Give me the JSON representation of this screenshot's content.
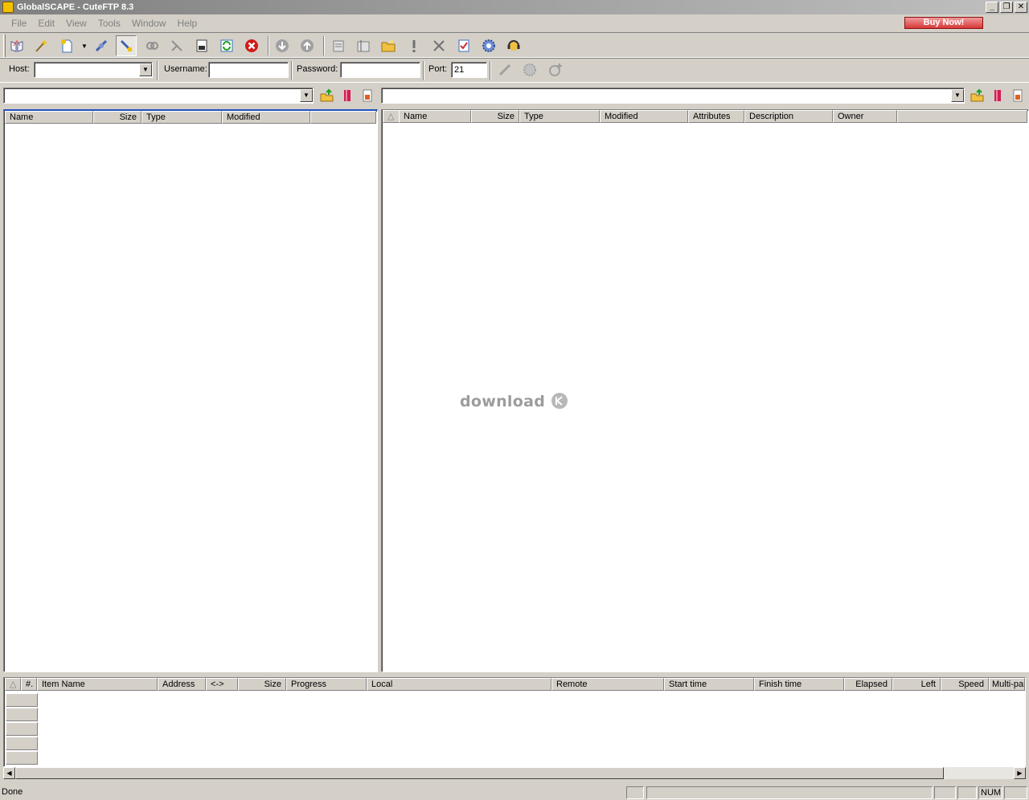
{
  "window": {
    "title": "GlobalSCAPE - CuteFTP 8.3",
    "minimize_glyph": "_",
    "restore_glyph": "❐",
    "close_glyph": "✕"
  },
  "menu": [
    "File",
    "Edit",
    "View",
    "Tools",
    "Window",
    "Help"
  ],
  "buy_now": "Buy Now!",
  "toolbar_icons": [
    "site-manager-icon",
    "connection-wizard-icon",
    "new-document-icon",
    "dropdown-arrow-icon",
    "quick-connect-icon",
    "disconnect-icon",
    "reconnect-icon",
    "stop-icon",
    "url-connect-icon",
    "refresh-icon",
    "cancel-icon",
    "download-icon",
    "upload-icon",
    "view-icon",
    "edit-icon",
    "new-folder-icon",
    "execute-icon",
    "delete-icon",
    "properties-icon",
    "settings-icon",
    "help-icon"
  ],
  "connection_bar": {
    "host_label": "Host:",
    "host_value": "",
    "username_label": "Username:",
    "username_value": "",
    "password_label": "Password:",
    "password_value": "",
    "port_label": "Port:",
    "port_value": "21"
  },
  "local_pane": {
    "path": "",
    "columns": [
      "Name",
      "Size",
      "Type",
      "Modified"
    ]
  },
  "remote_pane": {
    "path": "",
    "sort_indicator": "△",
    "columns": [
      "Name",
      "Size",
      "Type",
      "Modified",
      "Attributes",
      "Description",
      "Owner"
    ]
  },
  "watermark": "download",
  "queue": {
    "sort_indicator": "△",
    "columns": [
      "#.",
      "Item Name",
      "Address",
      "<->",
      "Size",
      "Progress",
      "Local",
      "Remote",
      "Start time",
      "Finish time",
      "Elapsed",
      "Left",
      "Speed",
      "Multi-par"
    ]
  },
  "scrollbar": {
    "left_glyph": "◀",
    "right_glyph": "▶"
  },
  "status": {
    "message": "Done",
    "num_indicator": "NUM"
  },
  "colors": {
    "chrome": "#d4d0c8",
    "buy_now_red": "#d83838",
    "cancel_red": "#d11a1a"
  }
}
